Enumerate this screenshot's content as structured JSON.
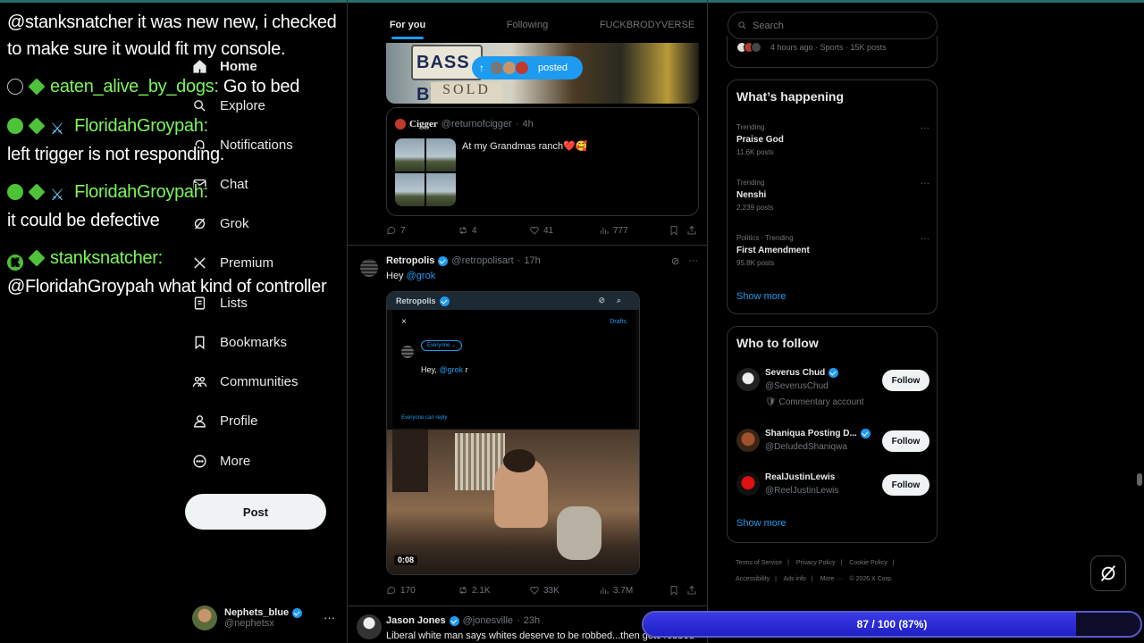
{
  "tabs": [
    {
      "label": "For you",
      "active": true
    },
    {
      "label": "Following",
      "active": false
    },
    {
      "label": "FUCKBRODYVERSE",
      "active": false
    }
  ],
  "nav": {
    "items": [
      {
        "label": "Home",
        "icon": "home-icon"
      },
      {
        "label": "Explore",
        "icon": "search-icon"
      },
      {
        "label": "Notifications",
        "icon": "bell-icon"
      },
      {
        "label": "Chat",
        "icon": "mail-icon"
      },
      {
        "label": "Grok",
        "icon": "grok-icon"
      },
      {
        "label": "Premium",
        "icon": "x-logo-icon"
      },
      {
        "label": "Lists",
        "icon": "list-icon"
      },
      {
        "label": "Bookmarks",
        "icon": "bookmark-icon"
      },
      {
        "label": "Communities",
        "icon": "people-icon"
      },
      {
        "label": "Profile",
        "icon": "person-icon"
      },
      {
        "label": "More",
        "icon": "more-circle-icon"
      }
    ],
    "post_label": "Post",
    "account": {
      "name": "Nephets_blue",
      "handle": "@nephetsx",
      "more": "···"
    }
  },
  "feed": {
    "posted_pill": {
      "label": "posted",
      "arrow": "↑"
    },
    "media_top": {
      "plate_text": "BASS BTN",
      "sold_text": "SOLD"
    },
    "quote": {
      "name": "Cigger",
      "handle": "@returnofcigger",
      "time": "4h",
      "text": "At my Grandmas ranch❤️🥰"
    },
    "tweet1_actions": {
      "replies": "7",
      "reposts": "4",
      "likes": "41",
      "views": "777"
    },
    "tweet2": {
      "name": "Retropolis",
      "handle": "@retropolisart",
      "time": "17h",
      "text_prefix": "Hey ",
      "mention": "@grok",
      "video": {
        "header_name": "Retropolis",
        "close": "×",
        "drafts": "Drafts",
        "audience": "Everyone ⌄",
        "compose_text": "Hey, ",
        "compose_mention": "@grok",
        "compose_suffix": " r",
        "reply_setting": "Everyone can reply",
        "timestamp": "0:08"
      },
      "actions": {
        "replies": "170",
        "reposts": "2.1K",
        "likes": "33K",
        "views": "3.7M"
      }
    },
    "tweet3": {
      "name": "Jason Jones",
      "handle": "@jonesville",
      "time": "23h",
      "text": "Liberal white man says whites deserve to be robbed...then gets robbed"
    }
  },
  "right": {
    "search_placeholder": "Search",
    "top_card_meta": "4 hours ago · Sports · 15K posts",
    "whats_happening": {
      "title": "What’s happening",
      "trends": [
        {
          "context": "Trending",
          "title": "Praise God",
          "count": "11.6K posts"
        },
        {
          "context": "Trending",
          "title": "Nenshi",
          "count": "2,239 posts"
        },
        {
          "context": "Politics · Trending",
          "title": "First Amendment",
          "count": "95.8K posts"
        }
      ],
      "show_more": "Show more"
    },
    "who_to_follow": {
      "title": "Who to follow",
      "accounts": [
        {
          "name": "Severus Chud",
          "handle": "@SeverusChud",
          "desc": "Commentary account",
          "verified": true,
          "follow": "Follow"
        },
        {
          "name": "Shaniqua Posting D...",
          "handle": "@DeIudedShaniqwa",
          "desc": "",
          "verified": true,
          "follow": "Follow"
        },
        {
          "name": "RealJustinLewis",
          "handle": "@ReelJustinLewis",
          "desc": "",
          "verified": false,
          "follow": "Follow"
        }
      ],
      "show_more": "Show more"
    },
    "footer_links": [
      "Terms of Service",
      "|",
      "Privacy Policy",
      "|",
      "Cookie Policy",
      "|",
      "Accessibility",
      "|",
      "Ads info",
      "|",
      "More ···",
      "© 2026 X Corp."
    ]
  },
  "progress": {
    "label": "87 / 100 (87%)",
    "fraction": 0.87
  },
  "chat": [
    {
      "user": "",
      "message": "@stanksnatcher it was new new, i checked"
    },
    {
      "user": "",
      "message": "to make sure it would fit my console."
    },
    {
      "user": "eaten_alive_by_dogs:",
      "message": "Go to bed"
    },
    {
      "user": "FloridahGroypah:",
      "message": ""
    },
    {
      "user": "",
      "message": "left trigger is not responding."
    },
    {
      "user": "FloridahGroypah:",
      "message": ""
    },
    {
      "user": "",
      "message": "it could be defective"
    },
    {
      "user": "stanksnatcher:",
      "message": ""
    },
    {
      "user": "",
      "message": "@FloridahGroypah what kind of controller"
    }
  ],
  "colors": {
    "accent": "#1d9bf0",
    "chat_user": "#7cf55b",
    "progress_fill": "#2a2ad8"
  }
}
